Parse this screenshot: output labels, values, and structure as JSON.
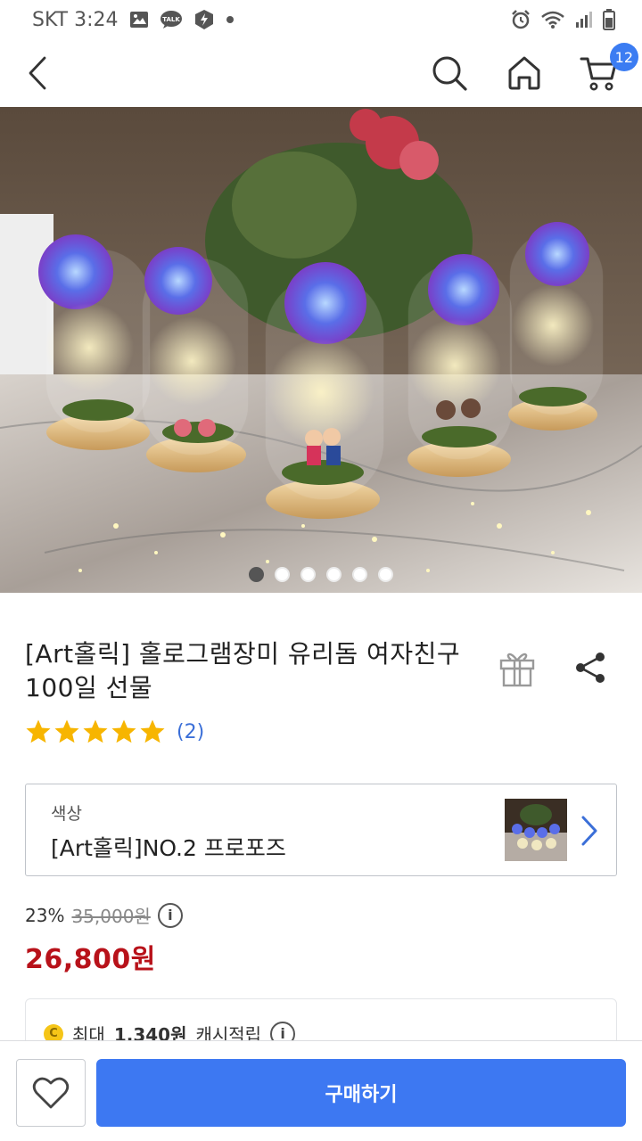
{
  "status_bar": {
    "carrier_time": "SKT 3:24",
    "left_icons": [
      "image-icon",
      "talk-icon",
      "lightning-shield-icon",
      "dot-icon"
    ],
    "right_icons": [
      "alarm-icon",
      "wifi-icon",
      "signal-icon",
      "battery-icon"
    ],
    "talk_label": "TALK"
  },
  "nav": {
    "icons": [
      "back-chevron-icon",
      "search-icon",
      "home-icon",
      "cart-icon"
    ],
    "cart_count": "12",
    "accent_color": "#3b7cf2"
  },
  "gallery": {
    "slide_count": 6,
    "active_index": 0
  },
  "product": {
    "title": "[Art홀릭] 홀로그램장미 유리돔 여자친구 100일 선물",
    "rating": 5,
    "rating_max": 5,
    "review_count": "(2)",
    "icons": [
      "gift-icon",
      "share-icon",
      "star-icon"
    ]
  },
  "option": {
    "label": "색상",
    "value": "[Art홀릭]NO.2 프로포즈"
  },
  "price": {
    "discount_rate": "23%",
    "original_price": "35,000원",
    "sale_price": "26,800원",
    "sale_color": "#b8121a"
  },
  "cash": {
    "prefix": "최대",
    "amount": "1,340원",
    "suffix": "캐시적립",
    "coin_symbol": "C"
  },
  "bottom_bar": {
    "buy_label": "구매하기",
    "buy_color": "#3d78f2",
    "wish_icon": "heart-icon"
  }
}
